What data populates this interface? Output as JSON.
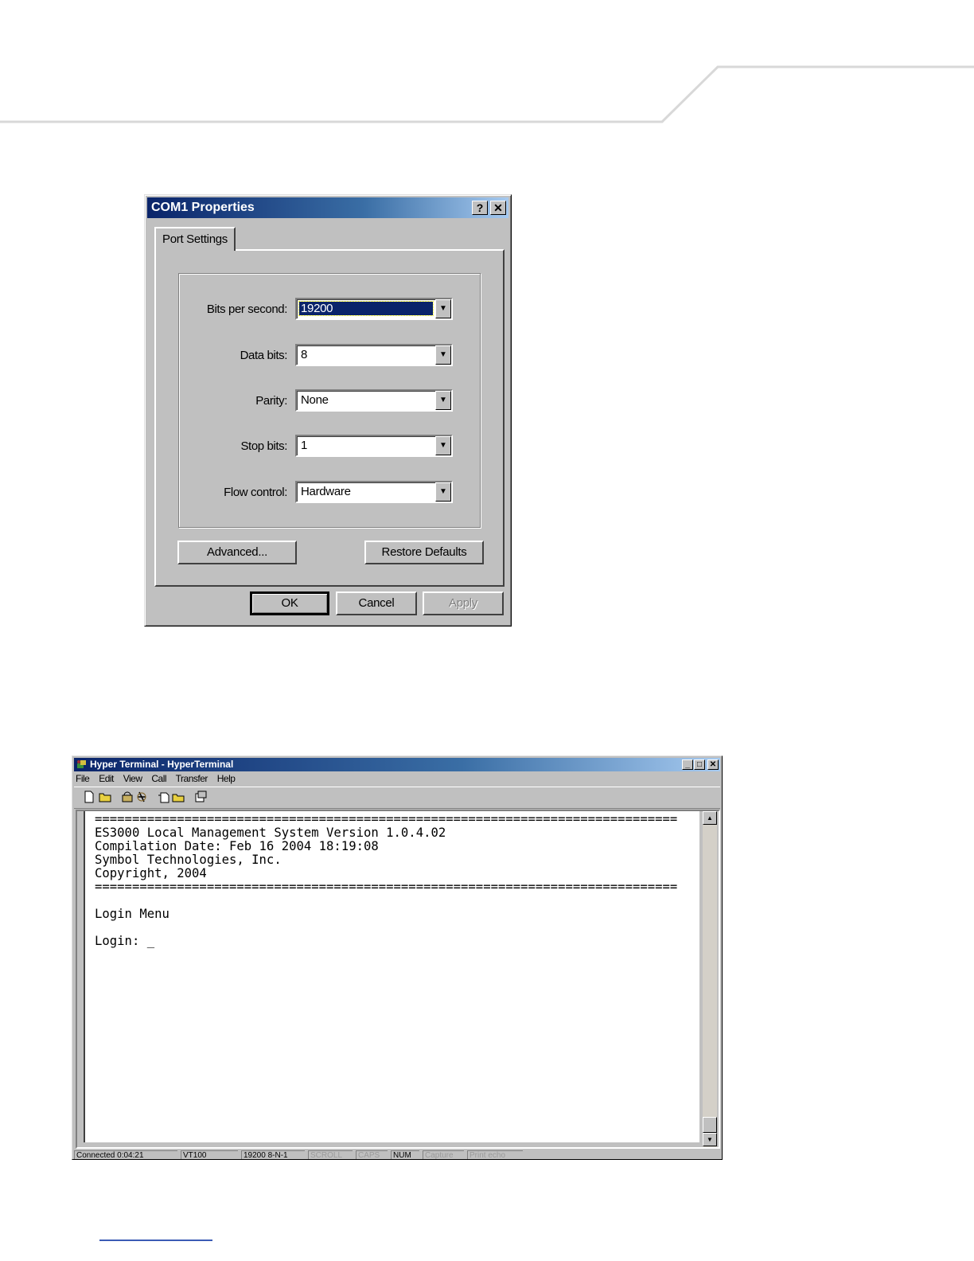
{
  "com1_dialog": {
    "title": "COM1 Properties",
    "help_button": "?",
    "close_button": "✕",
    "tab_label": "Port Settings",
    "fields": [
      {
        "label": "Bits per second:",
        "value": "19200"
      },
      {
        "label": "Data bits:",
        "value": "8"
      },
      {
        "label": "Parity:",
        "value": "None"
      },
      {
        "label": "Stop bits:",
        "value": "1"
      },
      {
        "label": "Flow control:",
        "value": "Hardware"
      }
    ],
    "advanced_button": "Advanced...",
    "restore_defaults_button": "Restore Defaults",
    "ok_button": "OK",
    "cancel_button": "Cancel",
    "apply_button": "Apply"
  },
  "hyperterminal": {
    "title": "Hyper Terminal - HyperTerminal",
    "window_buttons": [
      "_",
      "□",
      "✕"
    ],
    "menu": [
      "File",
      "Edit",
      "View",
      "Call",
      "Transfer",
      "Help"
    ],
    "toolbar_icons": [
      "new-icon",
      "open-icon",
      "connect-icon",
      "disconnect-icon",
      "send-icon",
      "receive-icon",
      "properties-icon"
    ],
    "terminal_lines": [
      "==============================================================================",
      "ES3000 Local Management System Version 1.0.4.02",
      "Compilation Date: Feb 16 2004 18:19:08",
      "Symbol Technologies, Inc.",
      "Copyright, 2004",
      "==============================================================================",
      "",
      "Login Menu",
      "",
      "Login: _"
    ],
    "status": [
      "Connected 0:04:21",
      "VT100",
      "19200 8-N-1",
      "SCROLL",
      "CAPS",
      "NUM",
      "Capture",
      "Print echo"
    ]
  }
}
